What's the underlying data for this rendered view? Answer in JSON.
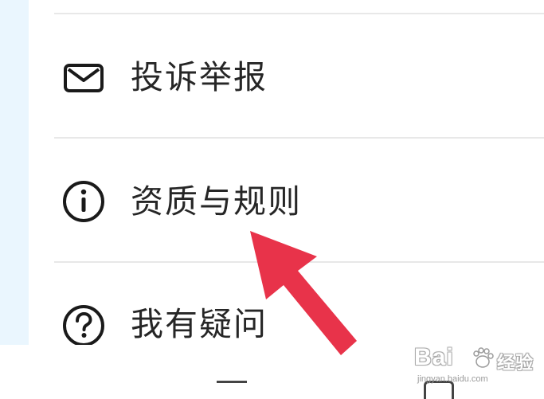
{
  "menu": {
    "items": [
      {
        "label": "投诉举报",
        "icon": "mail-icon"
      },
      {
        "label": "资质与规则",
        "icon": "info-icon"
      },
      {
        "label": "我有疑问",
        "icon": "question-icon"
      }
    ]
  },
  "annotation": {
    "arrow_color": "#e8334a"
  },
  "watermark": {
    "brand": "Bai",
    "brand_cn": "经验",
    "url": "jingyan.baidu.com"
  }
}
